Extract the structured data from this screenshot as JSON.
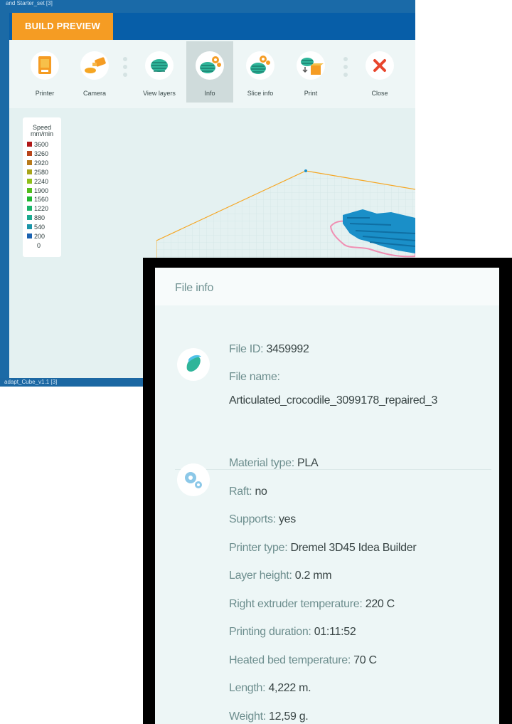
{
  "app": {
    "window_title": "and Starter_set [3]",
    "footer_text": "adapt_Cube_v1.1 [3]"
  },
  "build_preview": {
    "tab_label": "BUILD PREVIEW",
    "toolbar": [
      {
        "label": "Printer",
        "icon": "printer-icon"
      },
      {
        "label": "Camera",
        "icon": "camera-icon"
      },
      {
        "label": "View layers",
        "icon": "layers-icon"
      },
      {
        "label": "Info",
        "icon": "info-gear-icon",
        "active": true
      },
      {
        "label": "Slice info",
        "icon": "slice-info-icon"
      },
      {
        "label": "Print",
        "icon": "print-box-icon"
      },
      {
        "label": "Close",
        "icon": "close-x-icon"
      }
    ],
    "legend": {
      "title_line1": "Speed",
      "title_line2": "mm/min",
      "entries": [
        {
          "value": "3600",
          "color": "#b01818"
        },
        {
          "value": "3260",
          "color": "#b8451a"
        },
        {
          "value": "2920",
          "color": "#b87a1a"
        },
        {
          "value": "2580",
          "color": "#a8a51a"
        },
        {
          "value": "2240",
          "color": "#8fbf1a"
        },
        {
          "value": "1900",
          "color": "#52bd1e"
        },
        {
          "value": "1560",
          "color": "#1fb832"
        },
        {
          "value": "1220",
          "color": "#1ab36a"
        },
        {
          "value": "880",
          "color": "#1aa990"
        },
        {
          "value": "540",
          "color": "#1a95a8"
        },
        {
          "value": "200",
          "color": "#1a62b0"
        },
        {
          "value": "0",
          "color": ""
        }
      ]
    }
  },
  "file_info": {
    "title": "File info",
    "file_id_label": "File ID:",
    "file_id_value": "3459992",
    "file_name_label": "File name:",
    "file_name_value": "Articulated_crocodile_3099178_repaired_3",
    "details": [
      {
        "label": "Material type:",
        "value": "PLA"
      },
      {
        "label": "Raft:",
        "value": "no"
      },
      {
        "label": "Supports:",
        "value": "yes"
      },
      {
        "label": "Printer type:",
        "value": "Dremel 3D45 Idea Builder"
      },
      {
        "label": "Layer height:",
        "value": "0.2 mm"
      },
      {
        "label": "Right extruder temperature:",
        "value": "220 C"
      },
      {
        "label": "Printing duration:",
        "value": "01:11:52"
      },
      {
        "label": "Heated bed temperature:",
        "value": "70 C"
      },
      {
        "label": "Length:",
        "value": "4,222 m."
      },
      {
        "label": "Weight:",
        "value": "12,59 g."
      }
    ]
  },
  "colors": {
    "accent_orange": "#f59c23",
    "header_blue": "#075ea8",
    "panel_bg": "#e4f1f1",
    "close_red": "#e8452c"
  }
}
